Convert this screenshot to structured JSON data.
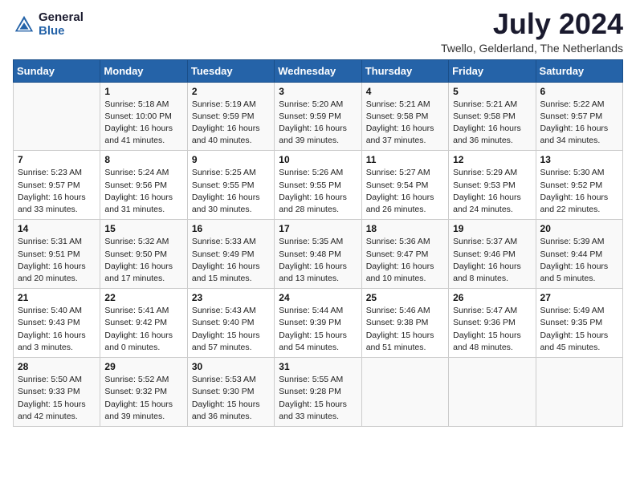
{
  "header": {
    "logo_general": "General",
    "logo_blue": "Blue",
    "month_title": "July 2024",
    "location": "Twello, Gelderland, The Netherlands"
  },
  "weekdays": [
    "Sunday",
    "Monday",
    "Tuesday",
    "Wednesday",
    "Thursday",
    "Friday",
    "Saturday"
  ],
  "weeks": [
    [
      {
        "day": "",
        "info": ""
      },
      {
        "day": "1",
        "info": "Sunrise: 5:18 AM\nSunset: 10:00 PM\nDaylight: 16 hours\nand 41 minutes."
      },
      {
        "day": "2",
        "info": "Sunrise: 5:19 AM\nSunset: 9:59 PM\nDaylight: 16 hours\nand 40 minutes."
      },
      {
        "day": "3",
        "info": "Sunrise: 5:20 AM\nSunset: 9:59 PM\nDaylight: 16 hours\nand 39 minutes."
      },
      {
        "day": "4",
        "info": "Sunrise: 5:21 AM\nSunset: 9:58 PM\nDaylight: 16 hours\nand 37 minutes."
      },
      {
        "day": "5",
        "info": "Sunrise: 5:21 AM\nSunset: 9:58 PM\nDaylight: 16 hours\nand 36 minutes."
      },
      {
        "day": "6",
        "info": "Sunrise: 5:22 AM\nSunset: 9:57 PM\nDaylight: 16 hours\nand 34 minutes."
      }
    ],
    [
      {
        "day": "7",
        "info": "Sunrise: 5:23 AM\nSunset: 9:57 PM\nDaylight: 16 hours\nand 33 minutes."
      },
      {
        "day": "8",
        "info": "Sunrise: 5:24 AM\nSunset: 9:56 PM\nDaylight: 16 hours\nand 31 minutes."
      },
      {
        "day": "9",
        "info": "Sunrise: 5:25 AM\nSunset: 9:55 PM\nDaylight: 16 hours\nand 30 minutes."
      },
      {
        "day": "10",
        "info": "Sunrise: 5:26 AM\nSunset: 9:55 PM\nDaylight: 16 hours\nand 28 minutes."
      },
      {
        "day": "11",
        "info": "Sunrise: 5:27 AM\nSunset: 9:54 PM\nDaylight: 16 hours\nand 26 minutes."
      },
      {
        "day": "12",
        "info": "Sunrise: 5:29 AM\nSunset: 9:53 PM\nDaylight: 16 hours\nand 24 minutes."
      },
      {
        "day": "13",
        "info": "Sunrise: 5:30 AM\nSunset: 9:52 PM\nDaylight: 16 hours\nand 22 minutes."
      }
    ],
    [
      {
        "day": "14",
        "info": "Sunrise: 5:31 AM\nSunset: 9:51 PM\nDaylight: 16 hours\nand 20 minutes."
      },
      {
        "day": "15",
        "info": "Sunrise: 5:32 AM\nSunset: 9:50 PM\nDaylight: 16 hours\nand 17 minutes."
      },
      {
        "day": "16",
        "info": "Sunrise: 5:33 AM\nSunset: 9:49 PM\nDaylight: 16 hours\nand 15 minutes."
      },
      {
        "day": "17",
        "info": "Sunrise: 5:35 AM\nSunset: 9:48 PM\nDaylight: 16 hours\nand 13 minutes."
      },
      {
        "day": "18",
        "info": "Sunrise: 5:36 AM\nSunset: 9:47 PM\nDaylight: 16 hours\nand 10 minutes."
      },
      {
        "day": "19",
        "info": "Sunrise: 5:37 AM\nSunset: 9:46 PM\nDaylight: 16 hours\nand 8 minutes."
      },
      {
        "day": "20",
        "info": "Sunrise: 5:39 AM\nSunset: 9:44 PM\nDaylight: 16 hours\nand 5 minutes."
      }
    ],
    [
      {
        "day": "21",
        "info": "Sunrise: 5:40 AM\nSunset: 9:43 PM\nDaylight: 16 hours\nand 3 minutes."
      },
      {
        "day": "22",
        "info": "Sunrise: 5:41 AM\nSunset: 9:42 PM\nDaylight: 16 hours\nand 0 minutes."
      },
      {
        "day": "23",
        "info": "Sunrise: 5:43 AM\nSunset: 9:40 PM\nDaylight: 15 hours\nand 57 minutes."
      },
      {
        "day": "24",
        "info": "Sunrise: 5:44 AM\nSunset: 9:39 PM\nDaylight: 15 hours\nand 54 minutes."
      },
      {
        "day": "25",
        "info": "Sunrise: 5:46 AM\nSunset: 9:38 PM\nDaylight: 15 hours\nand 51 minutes."
      },
      {
        "day": "26",
        "info": "Sunrise: 5:47 AM\nSunset: 9:36 PM\nDaylight: 15 hours\nand 48 minutes."
      },
      {
        "day": "27",
        "info": "Sunrise: 5:49 AM\nSunset: 9:35 PM\nDaylight: 15 hours\nand 45 minutes."
      }
    ],
    [
      {
        "day": "28",
        "info": "Sunrise: 5:50 AM\nSunset: 9:33 PM\nDaylight: 15 hours\nand 42 minutes."
      },
      {
        "day": "29",
        "info": "Sunrise: 5:52 AM\nSunset: 9:32 PM\nDaylight: 15 hours\nand 39 minutes."
      },
      {
        "day": "30",
        "info": "Sunrise: 5:53 AM\nSunset: 9:30 PM\nDaylight: 15 hours\nand 36 minutes."
      },
      {
        "day": "31",
        "info": "Sunrise: 5:55 AM\nSunset: 9:28 PM\nDaylight: 15 hours\nand 33 minutes."
      },
      {
        "day": "",
        "info": ""
      },
      {
        "day": "",
        "info": ""
      },
      {
        "day": "",
        "info": ""
      }
    ]
  ]
}
